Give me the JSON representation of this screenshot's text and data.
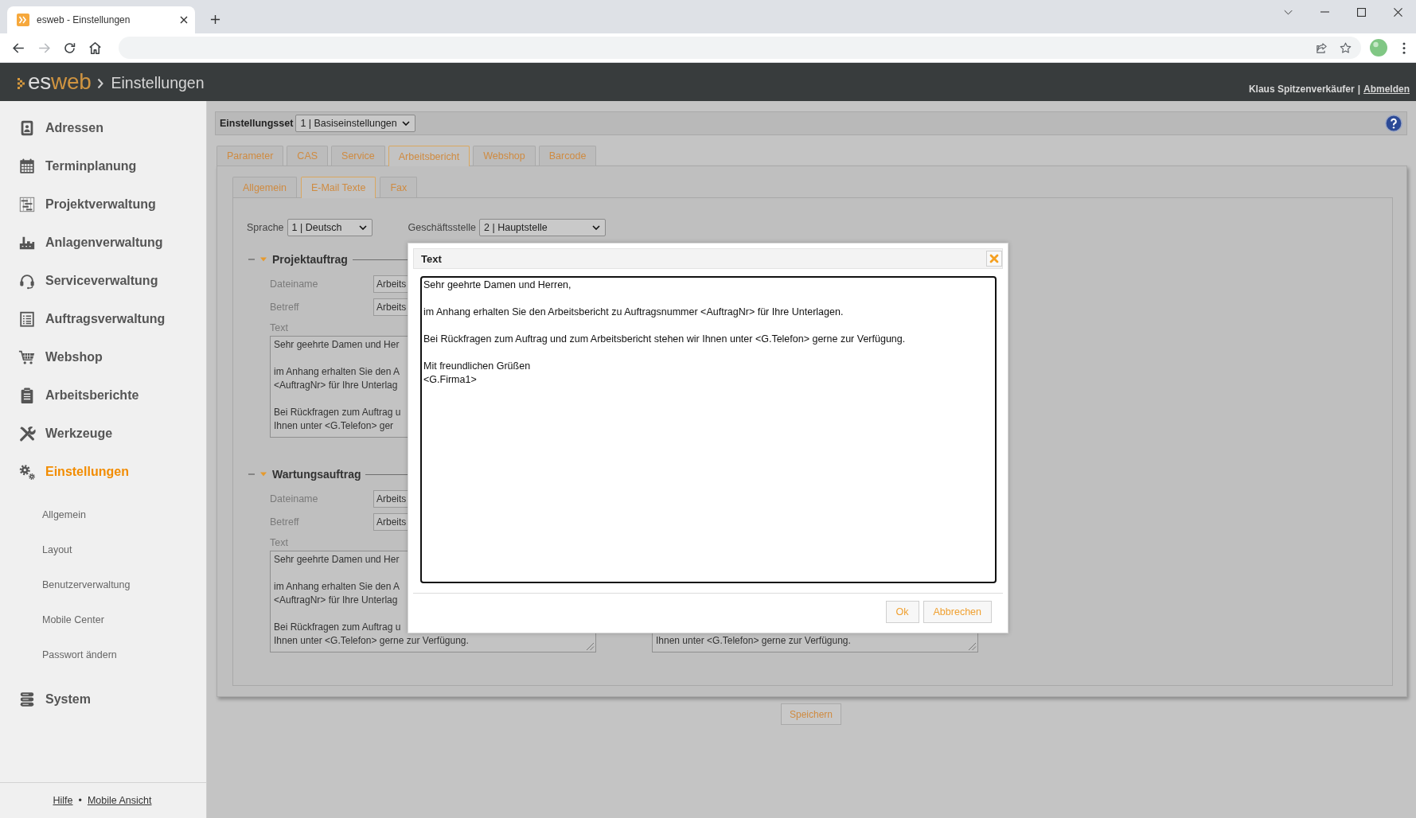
{
  "browser": {
    "tab": {
      "title": "esweb - Einstellungen",
      "selected": true
    },
    "forward_disabled": true
  },
  "header": {
    "logo": {
      "part_1": "es",
      "part_2": "web"
    },
    "breadcrumb": "Einstellungen",
    "user": "Klaus Spitzenverkäufer",
    "separator": "|",
    "logout": "Abmelden"
  },
  "sidebar": {
    "items": [
      {
        "label": "Adressen",
        "selected": false
      },
      {
        "label": "Terminplanung",
        "selected": false
      },
      {
        "label": "Projektverwaltung",
        "selected": false
      },
      {
        "label": "Anlagenverwaltung",
        "selected": false
      },
      {
        "label": "Serviceverwaltung",
        "selected": false
      },
      {
        "label": "Auftragsverwaltung",
        "selected": false
      },
      {
        "label": "Webshop",
        "selected": false
      },
      {
        "label": "Arbeitsberichte",
        "selected": false
      },
      {
        "label": "Werkzeuge",
        "selected": false
      },
      {
        "label": "Einstellungen",
        "selected": true,
        "children": [
          {
            "label": "Allgemein",
            "selected": false
          },
          {
            "label": "Layout",
            "selected": false
          },
          {
            "label": "Benutzerverwaltung",
            "selected": false
          },
          {
            "label": "Mobile Center",
            "selected": false
          },
          {
            "label": "Passwort ändern",
            "selected": false
          }
        ]
      },
      {
        "label": "System",
        "selected": false
      }
    ],
    "footer": {
      "links": [
        "Hilfe",
        "Mobile Ansicht"
      ],
      "separator": "•"
    }
  },
  "settings_set": {
    "label": "Einstellungsset",
    "value": "1 | Basiseinstellungen"
  },
  "tabs": [
    {
      "label": "Parameter",
      "selected": false
    },
    {
      "label": "CAS",
      "selected": false
    },
    {
      "label": "Service",
      "selected": false
    },
    {
      "label": "Arbeitsbericht",
      "selected": true
    },
    {
      "label": "Webshop",
      "selected": false
    },
    {
      "label": "Barcode",
      "selected": false
    }
  ],
  "subtabs": [
    {
      "label": "Allgemein",
      "selected": false
    },
    {
      "label": "E-Mail Texte",
      "selected": true
    },
    {
      "label": "Fax",
      "selected": false
    }
  ],
  "filters": [
    {
      "label": "Sprache",
      "value": "1 | Deutsch"
    },
    {
      "label": "Geschäftsstelle",
      "value": "2 | Hauptstelle"
    }
  ],
  "sections": [
    {
      "title": "Projektauftrag",
      "expanded": true,
      "fields": [
        {
          "label": "Dateiname",
          "value": "Arbeits"
        },
        {
          "label": "Betreff",
          "value": "Arbeits"
        }
      ],
      "text_label": "Text",
      "text": [
        [
          "Sehr geehrte Damen und Her"
        ],
        [
          "im Anhang erhalten Sie den A",
          "<AuftragNr> für Ihre Unterlag"
        ],
        [
          "Bei Rückfragen zum Auftrag u",
          "Ihnen unter <G.Telefon> ger"
        ]
      ]
    },
    {
      "title": "Wartungsauftrag",
      "expanded": true,
      "fields": [
        {
          "label": "Dateiname",
          "value": "Arbeits"
        },
        {
          "label": "Betreff",
          "value": "Arbeits"
        }
      ],
      "text_label": "Text",
      "text": [
        [
          "Sehr geehrte Damen und Her"
        ],
        [
          "im Anhang erhalten Sie den A",
          "<AuftragNr> für Ihre Unterlag"
        ],
        [
          "Bei Rückfragen zum Auftrag u",
          "Ihnen unter <G.Telefon> gerne zur Verfügung."
        ]
      ],
      "right_text": [
        [
          "Ihnen unter <G.Telefon> gerne zur Verfügung."
        ]
      ]
    }
  ],
  "save_button": "Speichern",
  "dialog": {
    "title": "Text",
    "text": [
      [
        "Sehr geehrte Damen und Herren,"
      ],
      [
        "im Anhang erhalten Sie den Arbeitsbericht zu Auftragsnummer <AuftragNr> für Ihre Unterlagen."
      ],
      [
        "Bei Rückfragen zum Auftrag und zum Arbeitsbericht stehen wir Ihnen unter <G.Telefon> gerne zur Verfügung."
      ],
      [
        "Mit freundlichen Grüßen",
        "<G.Firma1>"
      ]
    ],
    "buttons": [
      "Ok",
      "Abbrechen"
    ]
  }
}
